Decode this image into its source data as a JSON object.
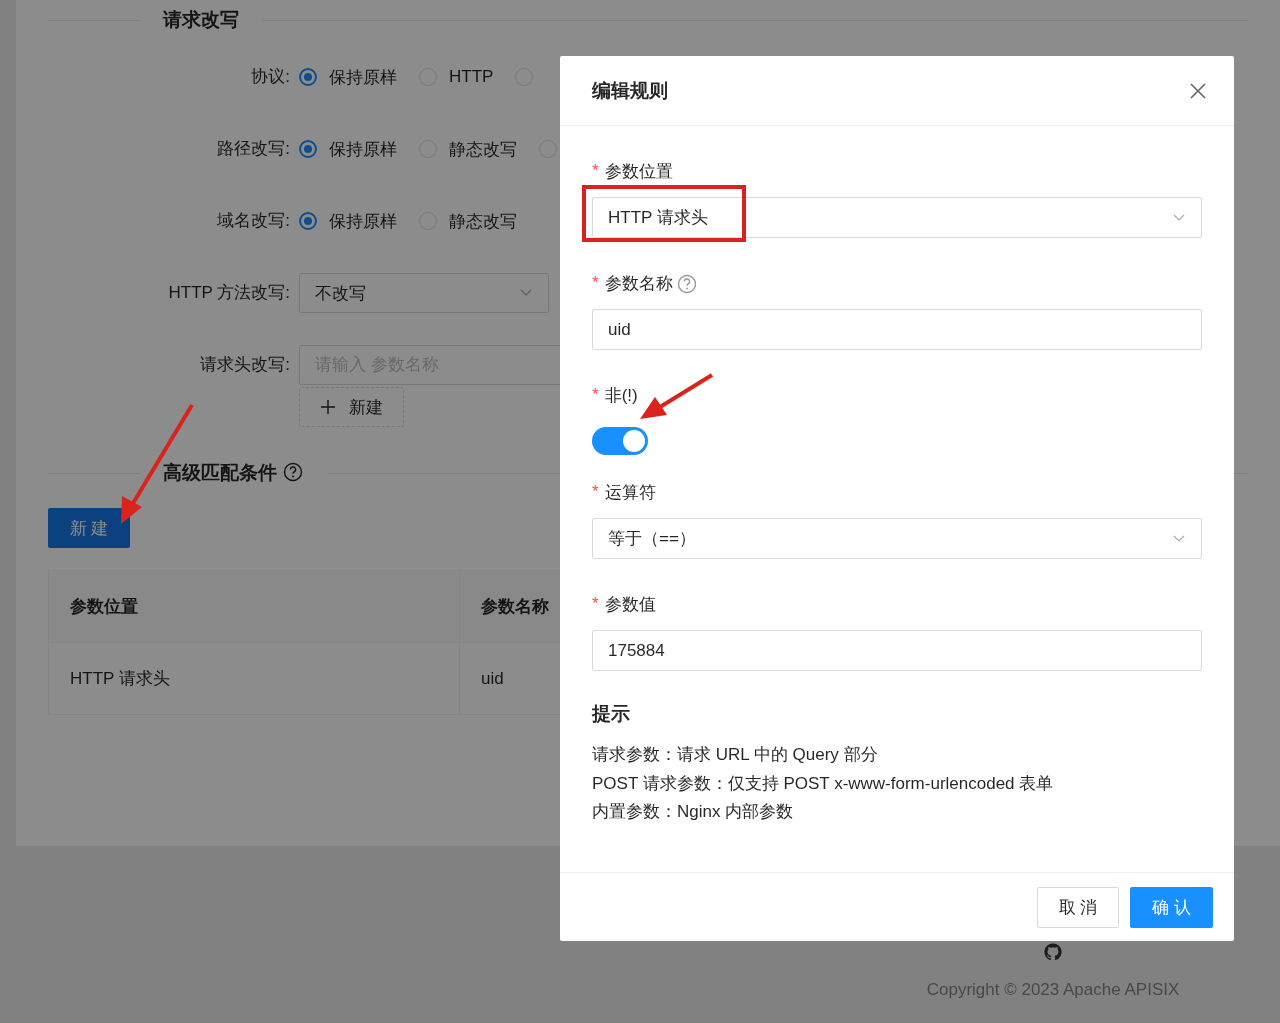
{
  "request_rewrite": {
    "title": "请求改写",
    "rows": [
      {
        "kind": "radio",
        "label": "协议:",
        "options": [
          {
            "label": "保持原样",
            "selected": true
          },
          {
            "label": "HTTP",
            "selected": false
          },
          {
            "selected": false
          }
        ]
      },
      {
        "kind": "radio",
        "label": "路径改写:",
        "options": [
          {
            "label": "保持原样",
            "selected": true
          },
          {
            "label": "静态改写",
            "selected": false
          },
          {
            "selected": false
          }
        ]
      },
      {
        "kind": "radio",
        "label": "域名改写:",
        "options": [
          {
            "label": "保持原样",
            "selected": true
          },
          {
            "label": "静态改写",
            "selected": false
          }
        ]
      },
      {
        "kind": "select",
        "label": "HTTP 方法改写:",
        "value": "不改写"
      },
      {
        "kind": "input",
        "label": "请求头改写:",
        "placeholder": "请输入 参数名称"
      }
    ],
    "add_button": "新建"
  },
  "advanced_match": {
    "title": "高级匹配条件",
    "new_button": "新 建",
    "table": {
      "columns": [
        "参数位置",
        "参数名称"
      ],
      "rows": [
        [
          "HTTP 请求头",
          "uid"
        ]
      ]
    }
  },
  "modal": {
    "title": "编辑规则",
    "fields": [
      {
        "kind": "select",
        "required_mark": "*",
        "label": "参数位置",
        "value": "HTTP 请求头"
      },
      {
        "kind": "input",
        "required_mark": "*",
        "label": "参数名称",
        "help": true,
        "value": "uid"
      },
      {
        "kind": "switch",
        "required_mark": "*",
        "label": "非(!)",
        "on": true
      },
      {
        "kind": "select",
        "required_mark": "*",
        "label": "运算符",
        "value": "等于（==）"
      },
      {
        "kind": "input",
        "required_mark": "*",
        "label": "参数值",
        "value": "175884"
      }
    ],
    "hint": {
      "title": "提示",
      "lines": [
        "请求参数：请求 URL 中的 Query 部分",
        "POST 请求参数：仅支持 POST x-www-form-urlencoded 表单",
        "内置参数：Nginx 内部参数"
      ]
    },
    "buttons": [
      {
        "label": "取 消",
        "kind": "default"
      },
      {
        "label": "确 认",
        "kind": "primary"
      }
    ]
  },
  "footer": {
    "copyright": "Copyright © 2023 Apache APISIX"
  }
}
